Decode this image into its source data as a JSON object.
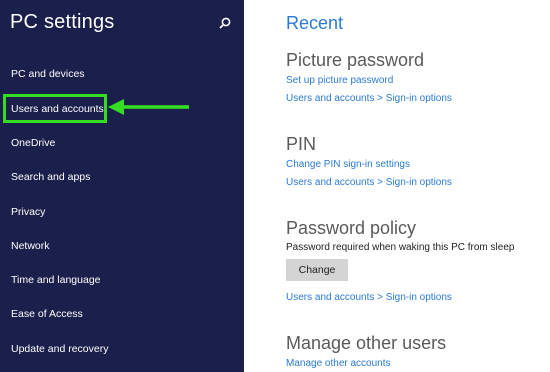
{
  "sidebar": {
    "title": "PC settings",
    "items": [
      {
        "label": "PC and devices"
      },
      {
        "label": "Users and accounts"
      },
      {
        "label": "OneDrive"
      },
      {
        "label": "Search and apps"
      },
      {
        "label": "Privacy"
      },
      {
        "label": "Network"
      },
      {
        "label": "Time and language"
      },
      {
        "label": "Ease of Access"
      },
      {
        "label": "Update and recovery"
      }
    ]
  },
  "colors": {
    "sidebar_bg": "#1b1f4c",
    "accent": "#2a7ad6",
    "highlight": "#33dd22"
  },
  "main": {
    "recent_heading": "Recent",
    "picture_password": {
      "title": "Picture password",
      "link1": "Set up picture password",
      "link2": "Users and accounts > Sign-in options"
    },
    "pin": {
      "title": "PIN",
      "link1": "Change PIN sign-in settings",
      "link2": "Users and accounts > Sign-in options"
    },
    "password_policy": {
      "title": "Password policy",
      "text": "Password required when waking this PC from sleep",
      "button": "Change",
      "link": "Users and accounts > Sign-in options"
    },
    "manage_users": {
      "title": "Manage other users",
      "link": "Manage other accounts"
    }
  }
}
